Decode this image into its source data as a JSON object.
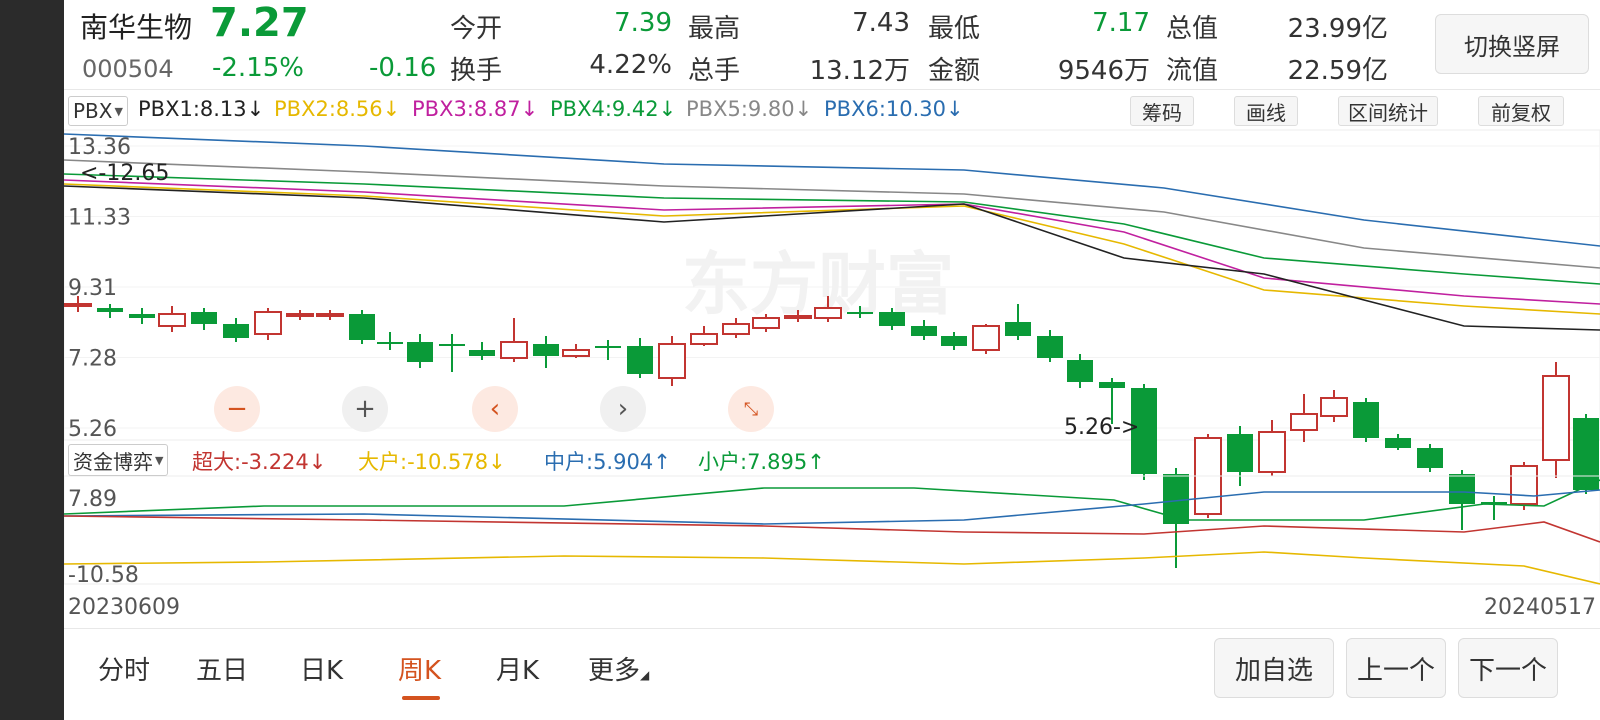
{
  "stock": {
    "name": "南华生物",
    "price": "7.27",
    "code": "000504",
    "change_pct": "-2.15%",
    "change": "-0.16"
  },
  "quote": {
    "open_label": "今开",
    "open": "7.39",
    "high_label": "最高",
    "high": "7.43",
    "low_label": "最低",
    "low": "7.17",
    "mktcap_label": "总值",
    "mktcap": "23.99亿",
    "turnover_label": "换手",
    "turnover": "4.22%",
    "volume_label": "总手",
    "volume": "13.12万",
    "amount_label": "金额",
    "amount": "9546万",
    "float_label": "流值",
    "float": "22.59亿"
  },
  "switch_label": "切换竖屏",
  "indicator": {
    "selector": "PBX",
    "pbx1": "PBX1:8.13↓",
    "pbx2": "PBX2:8.56↓",
    "pbx3": "PBX3:8.87↓",
    "pbx4": "PBX4:9.42↓",
    "pbx5": "PBX5:9.80↓",
    "pbx6": "PBX6:10.30↓"
  },
  "tools": {
    "chips": "筹码",
    "draw": "画线",
    "range": "区间统计",
    "adjust": "前复权"
  },
  "kline": {
    "yticks": [
      "13.36",
      "11.33",
      "9.31",
      "7.28",
      "5.26"
    ],
    "max_label": "<-12.65",
    "min_label": "5.26->",
    "watermark": "东方财富"
  },
  "flow": {
    "selector": "资金博弈",
    "super": "超大:-3.224↓",
    "large": "大户:-10.578↓",
    "medium": "中户:5.904↑",
    "small": "小户:7.895↑",
    "ymax": "7.89",
    "ymin": "-10.58"
  },
  "dates": {
    "start": "20230609",
    "end": "20240517"
  },
  "tabs": {
    "fenshi": "分时",
    "wuri": "五日",
    "rik": "日K",
    "zhouk": "周K",
    "yuek": "月K",
    "more": "更多"
  },
  "buttons": {
    "add_watch": "加自选",
    "prev": "上一个",
    "next": "下一个"
  },
  "colors": {
    "up": "#c23531",
    "down": "#0a9a38",
    "accent": "#d4531f"
  }
}
